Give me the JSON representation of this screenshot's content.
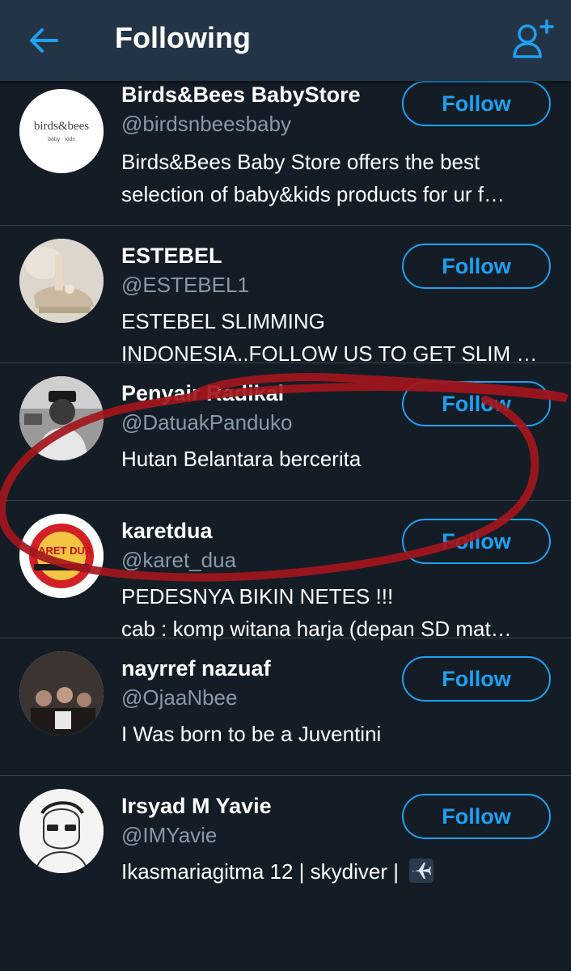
{
  "header": {
    "title": "Following",
    "back_icon": "back-arrow-icon",
    "add_icon": "add-user-icon",
    "accent": "#1da1f2"
  },
  "accounts": [
    {
      "name": "Birds&Bees BabyStore",
      "handle": "@birdsnbeesbaby",
      "bio": [
        "Birds&Bees Baby Store offers the best",
        "selection of baby&kids products for ur f…"
      ],
      "button": "Follow",
      "avatar_text": "birds&bees",
      "avatar_sub": "baby · kids"
    },
    {
      "name": "ESTEBEL",
      "handle": "@ESTEBEL1",
      "bio": [
        "ESTEBEL SLIMMING",
        "INDONESIA..FOLLOW US TO GET SLIM …"
      ],
      "button": "Follow"
    },
    {
      "name": "Penyair Radikal",
      "handle": "@DatuakPanduko",
      "bio": [
        "Hutan Belantara bercerita"
      ],
      "button": "Follow"
    },
    {
      "name": "karetdua",
      "handle": "@karet_dua",
      "bio": [
        "PEDESNYA BIKIN NETES !!!",
        "cab : komp witana harja (depan SD mat…"
      ],
      "button": "Follow",
      "avatar_text": "KARET DUA"
    },
    {
      "name": "nayrref nazuaf",
      "handle": "@OjaaNbee",
      "bio": [
        "I Was born to be a Juventini"
      ],
      "button": "Follow"
    },
    {
      "name": "Irsyad M Yavie",
      "handle": "@IMYavie",
      "bio": [
        "Ikasmariagitma 12 | skydiver | "
      ],
      "button": "Follow",
      "bio_icon": "airplane-icon"
    }
  ],
  "annotation_color": "#a3161c"
}
